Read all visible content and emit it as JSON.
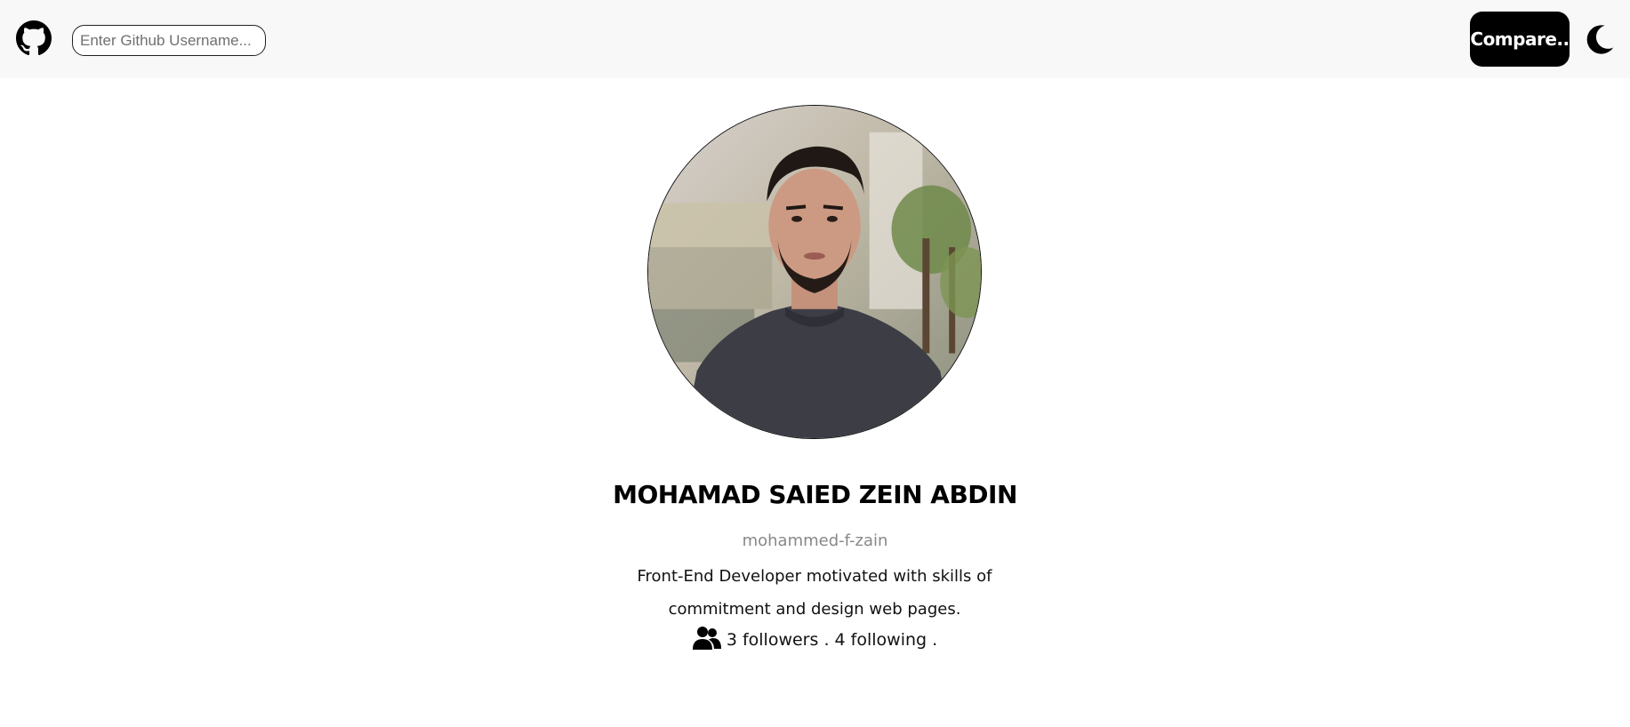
{
  "navbar": {
    "logo_icon": "github-icon",
    "search": {
      "placeholder": "Enter Github Username...",
      "value": ""
    },
    "compare_label": "Compare..",
    "theme_icon": "moon-icon"
  },
  "profile": {
    "avatar_icon": "profile-photo",
    "name": "MOHAMAD SAIED ZEIN ABDIN",
    "username": "mohammed-f-zain",
    "bio": "Front-End Developer motivated with skills of commitment and design web pages.",
    "followers_icon": "users-icon",
    "followers_count": "3",
    "followers_label": "followers",
    "separator": ".",
    "following_count": "4",
    "following_label": "following"
  },
  "colors": {
    "navbar_bg": "#f8f8f8",
    "button_bg": "#000000",
    "username": "#888888"
  }
}
